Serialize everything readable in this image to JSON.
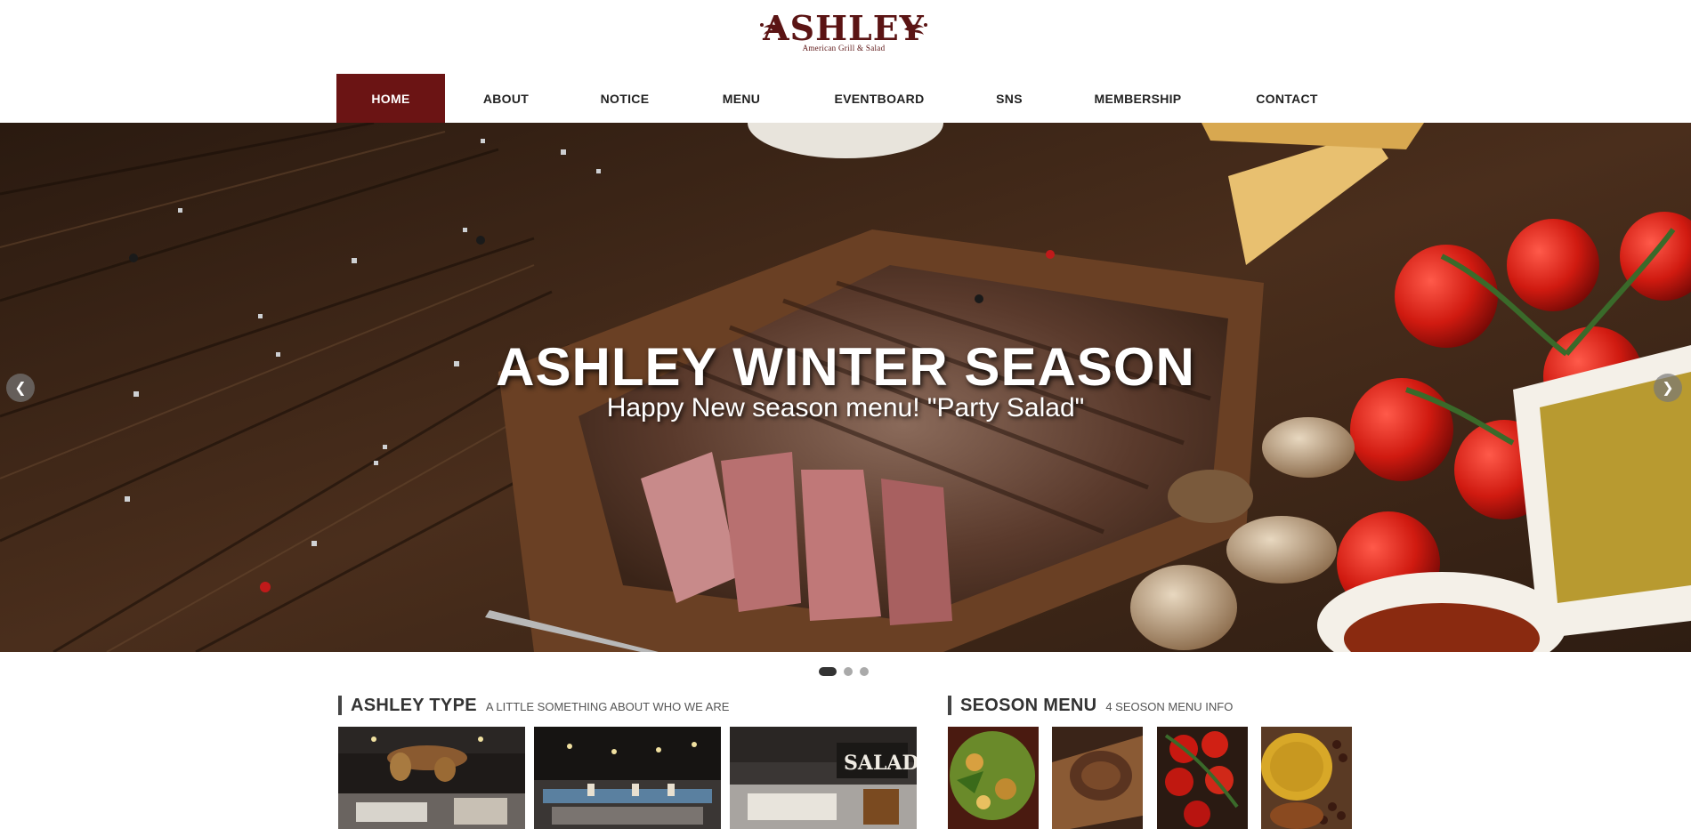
{
  "logo": {
    "name": "ASHLEY",
    "tagline": "American Grill & Salad"
  },
  "nav": {
    "items": [
      {
        "label": "HOME",
        "active": true
      },
      {
        "label": "ABOUT",
        "active": false
      },
      {
        "label": "NOTICE",
        "active": false
      },
      {
        "label": "MENU",
        "active": false
      },
      {
        "label": "EVENTBOARD",
        "active": false
      },
      {
        "label": "SNS",
        "active": false
      },
      {
        "label": "MEMBERSHIP",
        "active": false
      },
      {
        "label": "CONTACT",
        "active": false
      }
    ]
  },
  "hero": {
    "title": "ASHLEY WINTER SEASON",
    "subtitle": "Happy New season menu! \"Party Salad\"",
    "slides_total": 3,
    "active_slide": 1
  },
  "sections": {
    "type": {
      "title": "ASHLEY TYPE",
      "subtitle": "A LITTLE SOMETHING ABOUT WHO WE ARE"
    },
    "season": {
      "title": "SEOSON MENU",
      "subtitle": "4 SEOSON MENU INFO"
    }
  },
  "colors": {
    "brand": "#6b1414",
    "nav_text": "#222222",
    "section_bar": "#444444"
  }
}
